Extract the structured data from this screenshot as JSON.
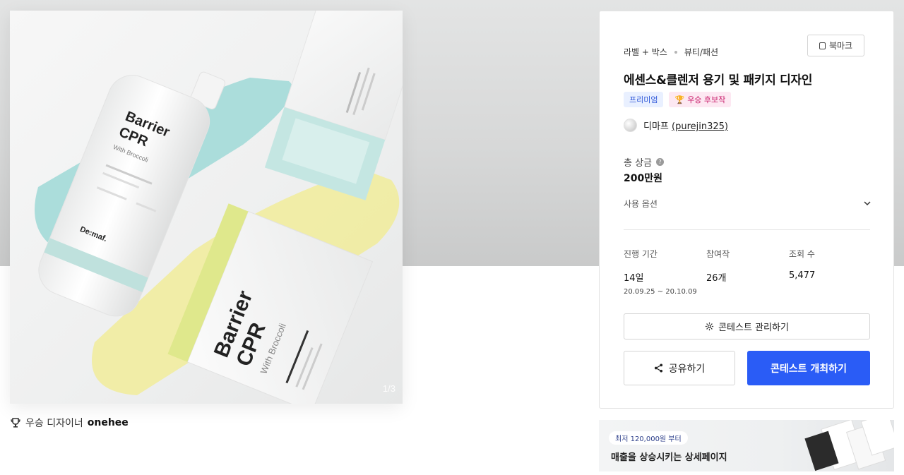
{
  "hero": {
    "image_counter": "1/3",
    "bottle_text": [
      "Barrier",
      "CPR",
      "With Broccoli"
    ],
    "box_text": [
      "Barrier",
      "CPR",
      "With Broccoli"
    ],
    "brand_mark": "De:maf."
  },
  "designer": {
    "prefix": "우승 디자이너",
    "name": "onehee"
  },
  "panel": {
    "breadcrumb": [
      "라벨 + 박스",
      "뷰티/패션"
    ],
    "bookmark_label": "북마크",
    "title": "에센스&클렌저 용기 및 패키지 디자인",
    "badges": {
      "premium": "프리미엄",
      "winner": "우승 후보작"
    },
    "owner": {
      "name": "디마프",
      "handle": "(purejin325)"
    },
    "prize": {
      "label": "총 상금",
      "value": "200만원"
    },
    "usage_option_label": "사용 옵션",
    "stats": [
      {
        "label": "진행 기간",
        "value": "14일",
        "sub": "20.09.25  ~  20.10.09"
      },
      {
        "label": "참여작",
        "value": "26개"
      },
      {
        "label": "조회 수",
        "value": "5,477"
      }
    ],
    "manage_button": "콘테스트 관리하기",
    "share_button": "공유하기",
    "host_button": "콘테스트 개최하기"
  },
  "banner": {
    "chip": "최저 120,000원 부터",
    "text": "매출을 상승시키는 상세페이지"
  },
  "colors": {
    "primary": "#2a5cf6",
    "premium_bg": "#e9f0ff",
    "winner_bg": "#fde8f2"
  }
}
